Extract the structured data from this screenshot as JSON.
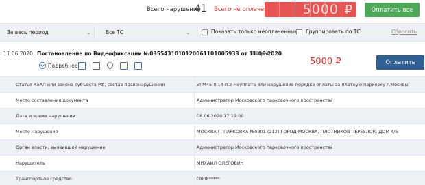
{
  "summary": {
    "total_label": "Всего нарушений",
    "total_count": "41",
    "unpaid_label": "Всего не оплачено",
    "unpaid_amount": "5000",
    "currency": "₽",
    "pay_all_label": "Оплатить все"
  },
  "filters": {
    "period": "За весь период",
    "vehicle": "Все ТС",
    "only_unpaid_label": "Показать только неоплаченные",
    "group_by_vehicle_label": "Группировать по ТС",
    "reset_label": "Сбросить"
  },
  "fine": {
    "date": "11.06.2020",
    "title": "Постановление по Видеофиксации №0355431010120061101005933 от 11.06.2020",
    "more_label": "Подробнее",
    "kind": "Штраф",
    "amount": "5000 ₽",
    "pay_label": "Оплатить"
  },
  "details": [
    {
      "label": "Статья КоАП или закона субъекта РФ, состав правонарушения",
      "value": "ЗГМ45-8.14 п.2 Неуплата или нарушение порядка оплаты за платную парковку г.Москвы"
    },
    {
      "label": "Место составления документа",
      "value": "Администратор Московского парковочного пространства"
    },
    {
      "label": "Дата и время нарушения",
      "value": "08.06.2020 17:19:00"
    },
    {
      "label": "Место нарушения",
      "value": "МОСКВА Г. ПАРКОВКА №0301 (212) ГОРОД МОСКВА, ПЛОТНИКОВ ПЕРЕУЛОК, ДОМ 4/5"
    },
    {
      "label": "Орган власти, выявивший нарушение",
      "value": "Администратор Московского парковочного пространства"
    },
    {
      "label": "Нарушитель",
      "value": "МИХАИЛ ОЛЕГОВИЧ"
    },
    {
      "label": "Транспортное средство",
      "value": "О808*****"
    }
  ],
  "colors": {
    "accent_red": "#d9342b",
    "pay_all_green": "#4fa85a",
    "pay_blue": "#2f5f93"
  }
}
